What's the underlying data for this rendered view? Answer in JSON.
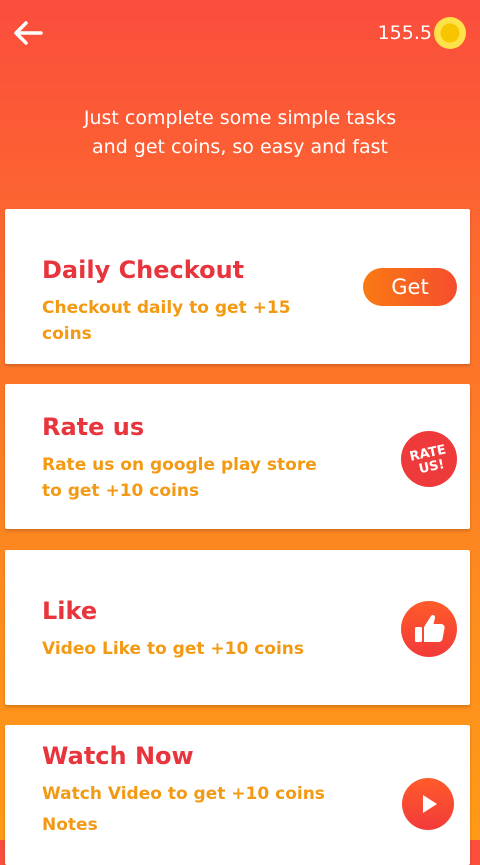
{
  "header": {
    "back_icon": "arrow-left-icon",
    "balance": "155.5",
    "coin_icon": "gold-coin-icon"
  },
  "intro": {
    "text": "Just complete some simple tasks\nand get coins, so easy and fast"
  },
  "tasks": [
    {
      "title": "Daily Checkout",
      "description": "Checkout daily to get +15 coins",
      "action_label": "Get"
    },
    {
      "title": "Rate us",
      "description": "Rate us on google play store to get +10 coins",
      "icon": "rate-us-icon",
      "icon_line1": "RATE",
      "icon_line2": "US!"
    },
    {
      "title": "Like",
      "description": "Video Like  to get +10 coins",
      "icon": "thumbs-up-icon"
    },
    {
      "title": "Watch Now",
      "description": "Watch Video to get +10 coins",
      "note": "Notes",
      "icon": "play-icon"
    }
  ],
  "colors": {
    "title_red": "#e8343c",
    "desc_orange": "#f39a14",
    "gradient_top": "#fb4d3d",
    "gradient_bottom": "#ff9a16"
  }
}
